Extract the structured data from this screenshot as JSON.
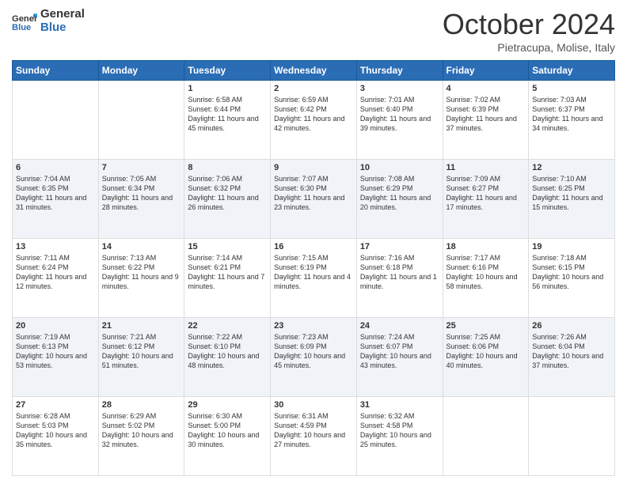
{
  "header": {
    "logo_general": "General",
    "logo_blue": "Blue",
    "month_title": "October 2024",
    "subtitle": "Pietracupa, Molise, Italy"
  },
  "days_of_week": [
    "Sunday",
    "Monday",
    "Tuesday",
    "Wednesday",
    "Thursday",
    "Friday",
    "Saturday"
  ],
  "weeks": [
    [
      {
        "day": "",
        "info": ""
      },
      {
        "day": "",
        "info": ""
      },
      {
        "day": "1",
        "info": "Sunrise: 6:58 AM\nSunset: 6:44 PM\nDaylight: 11 hours and 45 minutes."
      },
      {
        "day": "2",
        "info": "Sunrise: 6:59 AM\nSunset: 6:42 PM\nDaylight: 11 hours and 42 minutes."
      },
      {
        "day": "3",
        "info": "Sunrise: 7:01 AM\nSunset: 6:40 PM\nDaylight: 11 hours and 39 minutes."
      },
      {
        "day": "4",
        "info": "Sunrise: 7:02 AM\nSunset: 6:39 PM\nDaylight: 11 hours and 37 minutes."
      },
      {
        "day": "5",
        "info": "Sunrise: 7:03 AM\nSunset: 6:37 PM\nDaylight: 11 hours and 34 minutes."
      }
    ],
    [
      {
        "day": "6",
        "info": "Sunrise: 7:04 AM\nSunset: 6:35 PM\nDaylight: 11 hours and 31 minutes."
      },
      {
        "day": "7",
        "info": "Sunrise: 7:05 AM\nSunset: 6:34 PM\nDaylight: 11 hours and 28 minutes."
      },
      {
        "day": "8",
        "info": "Sunrise: 7:06 AM\nSunset: 6:32 PM\nDaylight: 11 hours and 26 minutes."
      },
      {
        "day": "9",
        "info": "Sunrise: 7:07 AM\nSunset: 6:30 PM\nDaylight: 11 hours and 23 minutes."
      },
      {
        "day": "10",
        "info": "Sunrise: 7:08 AM\nSunset: 6:29 PM\nDaylight: 11 hours and 20 minutes."
      },
      {
        "day": "11",
        "info": "Sunrise: 7:09 AM\nSunset: 6:27 PM\nDaylight: 11 hours and 17 minutes."
      },
      {
        "day": "12",
        "info": "Sunrise: 7:10 AM\nSunset: 6:25 PM\nDaylight: 11 hours and 15 minutes."
      }
    ],
    [
      {
        "day": "13",
        "info": "Sunrise: 7:11 AM\nSunset: 6:24 PM\nDaylight: 11 hours and 12 minutes."
      },
      {
        "day": "14",
        "info": "Sunrise: 7:13 AM\nSunset: 6:22 PM\nDaylight: 11 hours and 9 minutes."
      },
      {
        "day": "15",
        "info": "Sunrise: 7:14 AM\nSunset: 6:21 PM\nDaylight: 11 hours and 7 minutes."
      },
      {
        "day": "16",
        "info": "Sunrise: 7:15 AM\nSunset: 6:19 PM\nDaylight: 11 hours and 4 minutes."
      },
      {
        "day": "17",
        "info": "Sunrise: 7:16 AM\nSunset: 6:18 PM\nDaylight: 11 hours and 1 minute."
      },
      {
        "day": "18",
        "info": "Sunrise: 7:17 AM\nSunset: 6:16 PM\nDaylight: 10 hours and 58 minutes."
      },
      {
        "day": "19",
        "info": "Sunrise: 7:18 AM\nSunset: 6:15 PM\nDaylight: 10 hours and 56 minutes."
      }
    ],
    [
      {
        "day": "20",
        "info": "Sunrise: 7:19 AM\nSunset: 6:13 PM\nDaylight: 10 hours and 53 minutes."
      },
      {
        "day": "21",
        "info": "Sunrise: 7:21 AM\nSunset: 6:12 PM\nDaylight: 10 hours and 51 minutes."
      },
      {
        "day": "22",
        "info": "Sunrise: 7:22 AM\nSunset: 6:10 PM\nDaylight: 10 hours and 48 minutes."
      },
      {
        "day": "23",
        "info": "Sunrise: 7:23 AM\nSunset: 6:09 PM\nDaylight: 10 hours and 45 minutes."
      },
      {
        "day": "24",
        "info": "Sunrise: 7:24 AM\nSunset: 6:07 PM\nDaylight: 10 hours and 43 minutes."
      },
      {
        "day": "25",
        "info": "Sunrise: 7:25 AM\nSunset: 6:06 PM\nDaylight: 10 hours and 40 minutes."
      },
      {
        "day": "26",
        "info": "Sunrise: 7:26 AM\nSunset: 6:04 PM\nDaylight: 10 hours and 37 minutes."
      }
    ],
    [
      {
        "day": "27",
        "info": "Sunrise: 6:28 AM\nSunset: 5:03 PM\nDaylight: 10 hours and 35 minutes."
      },
      {
        "day": "28",
        "info": "Sunrise: 6:29 AM\nSunset: 5:02 PM\nDaylight: 10 hours and 32 minutes."
      },
      {
        "day": "29",
        "info": "Sunrise: 6:30 AM\nSunset: 5:00 PM\nDaylight: 10 hours and 30 minutes."
      },
      {
        "day": "30",
        "info": "Sunrise: 6:31 AM\nSunset: 4:59 PM\nDaylight: 10 hours and 27 minutes."
      },
      {
        "day": "31",
        "info": "Sunrise: 6:32 AM\nSunset: 4:58 PM\nDaylight: 10 hours and 25 minutes."
      },
      {
        "day": "",
        "info": ""
      },
      {
        "day": "",
        "info": ""
      }
    ]
  ]
}
